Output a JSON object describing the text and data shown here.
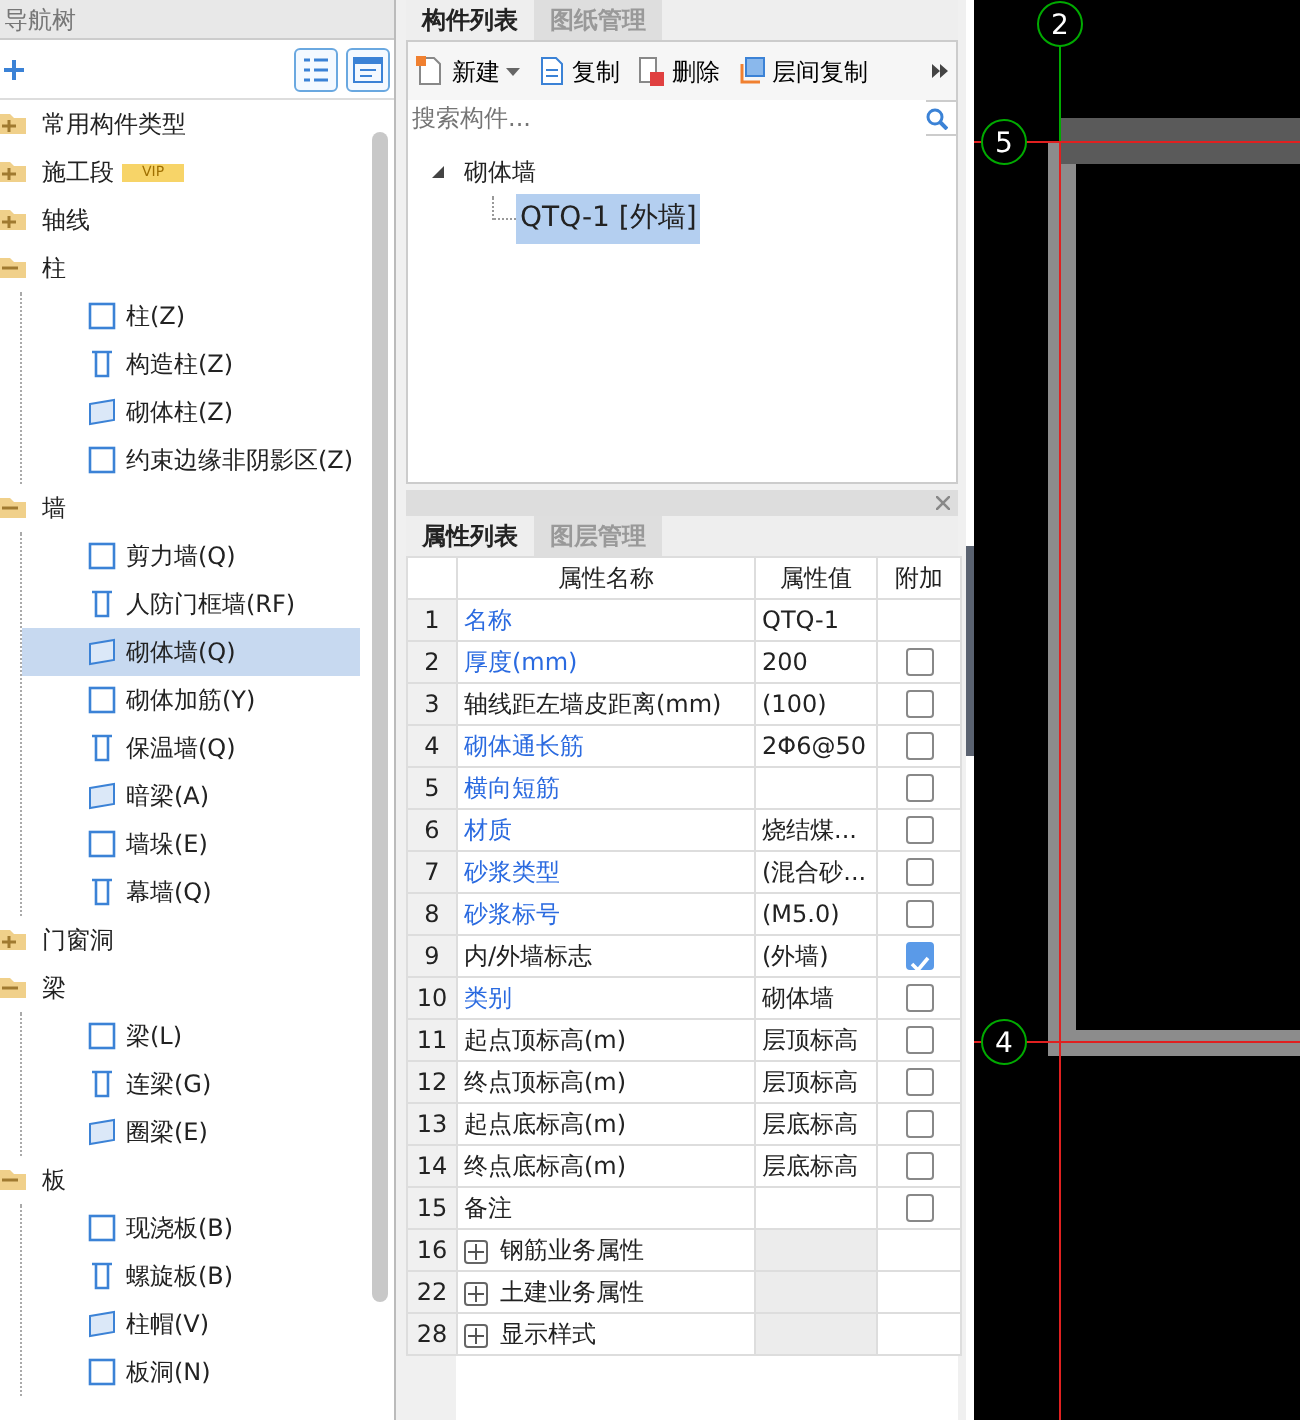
{
  "nav_tree": {
    "title": "导航树",
    "items": [
      {
        "label": "常用构件类型",
        "expanded": false,
        "selected": false
      },
      {
        "label": "施工段",
        "badge": "VIP",
        "expanded": false,
        "selected": false
      },
      {
        "label": "轴线",
        "expanded": false,
        "selected": false
      },
      {
        "label": "柱",
        "expanded": true,
        "selected": false,
        "children": [
          {
            "label": "柱(Z)",
            "selected": false
          },
          {
            "label": "构造柱(Z)",
            "selected": false
          },
          {
            "label": "砌体柱(Z)",
            "selected": false
          },
          {
            "label": "约束边缘非阴影区(Z)",
            "selected": false
          }
        ]
      },
      {
        "label": "墙",
        "expanded": true,
        "selected": false,
        "children": [
          {
            "label": "剪力墙(Q)",
            "selected": false
          },
          {
            "label": "人防门框墙(RF)",
            "selected": false
          },
          {
            "label": "砌体墙(Q)",
            "selected": true
          },
          {
            "label": "砌体加筋(Y)",
            "selected": false
          },
          {
            "label": "保温墙(Q)",
            "selected": false
          },
          {
            "label": "暗梁(A)",
            "selected": false
          },
          {
            "label": "墙垛(E)",
            "selected": false
          },
          {
            "label": "幕墙(Q)",
            "selected": false
          }
        ]
      },
      {
        "label": "门窗洞",
        "expanded": false,
        "selected": false
      },
      {
        "label": "梁",
        "expanded": true,
        "selected": false,
        "children": [
          {
            "label": "梁(L)",
            "selected": false
          },
          {
            "label": "连梁(G)",
            "selected": false
          },
          {
            "label": "圈梁(E)",
            "selected": false
          }
        ]
      },
      {
        "label": "板",
        "expanded": true,
        "selected": false,
        "children": [
          {
            "label": "现浇板(B)",
            "selected": false
          },
          {
            "label": "螺旋板(B)",
            "selected": false
          },
          {
            "label": "柱帽(V)",
            "selected": false
          },
          {
            "label": "板洞(N)",
            "selected": false
          }
        ]
      }
    ]
  },
  "component_panel": {
    "tabs": [
      {
        "label": "构件列表",
        "selected": true
      },
      {
        "label": "图纸管理",
        "selected": false
      }
    ],
    "toolbar": [
      {
        "label": "新建",
        "dropdown": true
      },
      {
        "label": "复制",
        "dropdown": false
      },
      {
        "label": "删除",
        "dropdown": false
      },
      {
        "label": "层间复制",
        "dropdown": false
      }
    ],
    "search": {
      "placeholder": "搜索构件..."
    },
    "tree": [
      {
        "label": "砌体墙",
        "expanded": true,
        "children": [
          {
            "label": "QTQ-1 [外墙]",
            "selected": true
          }
        ]
      }
    ]
  },
  "property_panel": {
    "tabs": [
      {
        "label": "属性列表",
        "selected": true
      },
      {
        "label": "图层管理",
        "selected": false
      }
    ],
    "columns": [
      "属性名称",
      "属性值",
      "附加"
    ],
    "rows": [
      {
        "kind": "prop",
        "index": "1",
        "name": "名称",
        "public": true,
        "value": "QTQ-1",
        "has_checkbox": false
      },
      {
        "kind": "prop",
        "index": "2",
        "name": "厚度(mm)",
        "public": true,
        "value": "200",
        "has_checkbox": true,
        "checked": false
      },
      {
        "kind": "prop",
        "index": "3",
        "name": "轴线距左墙皮距离(mm)",
        "public": false,
        "value": "(100)",
        "has_checkbox": true,
        "checked": false
      },
      {
        "kind": "prop",
        "index": "4",
        "name": "砌体通长筋",
        "public": true,
        "value": "2Φ6@50",
        "has_checkbox": true,
        "checked": false
      },
      {
        "kind": "prop",
        "index": "5",
        "name": "横向短筋",
        "public": true,
        "value": "",
        "has_checkbox": true,
        "checked": false
      },
      {
        "kind": "prop",
        "index": "6",
        "name": "材质",
        "public": true,
        "value": "烧结煤...",
        "has_checkbox": true,
        "checked": false
      },
      {
        "kind": "prop",
        "index": "7",
        "name": "砂浆类型",
        "public": true,
        "value": "(混合砂...",
        "has_checkbox": true,
        "checked": false
      },
      {
        "kind": "prop",
        "index": "8",
        "name": "砂浆标号",
        "public": true,
        "value": "(M5.0)",
        "has_checkbox": true,
        "checked": false
      },
      {
        "kind": "prop",
        "index": "9",
        "name": "内/外墙标志",
        "public": false,
        "value": "(外墙)",
        "has_checkbox": true,
        "checked": true
      },
      {
        "kind": "prop",
        "index": "10",
        "name": "类别",
        "public": true,
        "value": "砌体墙",
        "has_checkbox": true,
        "checked": false
      },
      {
        "kind": "prop",
        "index": "11",
        "name": "起点顶标高(m)",
        "public": false,
        "value": "层顶标高",
        "has_checkbox": true,
        "checked": false
      },
      {
        "kind": "prop",
        "index": "12",
        "name": "终点顶标高(m)",
        "public": false,
        "value": "层顶标高",
        "has_checkbox": true,
        "checked": false
      },
      {
        "kind": "prop",
        "index": "13",
        "name": "起点底标高(m)",
        "public": false,
        "value": "层底标高",
        "has_checkbox": true,
        "checked": false
      },
      {
        "kind": "prop",
        "index": "14",
        "name": "终点底标高(m)",
        "public": false,
        "value": "层底标高",
        "has_checkbox": true,
        "checked": false
      },
      {
        "kind": "prop",
        "index": "15",
        "name": "备注",
        "public": false,
        "value": "",
        "has_checkbox": true,
        "checked": false
      },
      {
        "kind": "group",
        "index": "16",
        "name": "钢筋业务属性",
        "expanded": false
      },
      {
        "kind": "group",
        "index": "22",
        "name": "土建业务属性",
        "expanded": false
      },
      {
        "kind": "group",
        "index": "28",
        "name": "显示样式",
        "expanded": false
      }
    ]
  },
  "canvas": {
    "axes": [
      {
        "label": "2"
      },
      {
        "label": "5"
      },
      {
        "label": "4"
      }
    ]
  }
}
